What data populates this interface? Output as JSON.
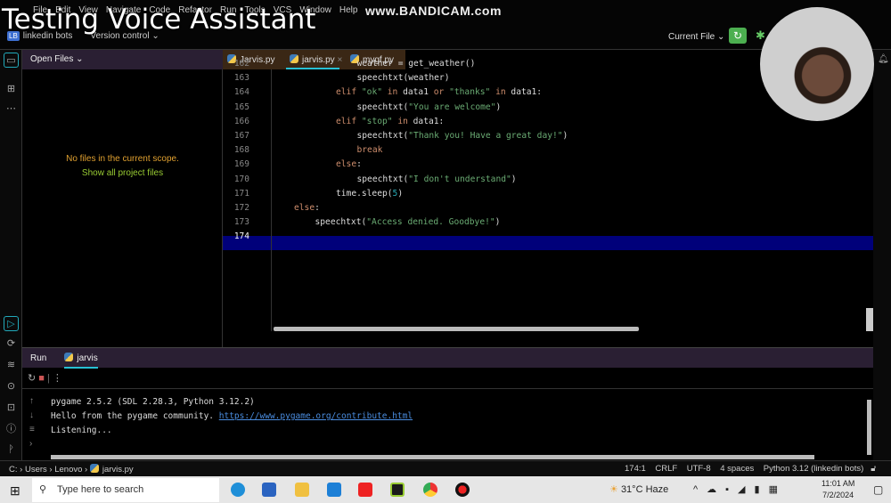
{
  "overlay": {
    "title": "Testing Voice Assistant",
    "watermark": "www.BANDICAM.com"
  },
  "menu": [
    "File",
    "Edit",
    "View",
    "Navigate",
    "Code",
    "Refactor",
    "Run",
    "Tools",
    "VCS",
    "Window",
    "Help"
  ],
  "project": {
    "badge": "LB",
    "name": "linkedin bots",
    "vcs": "Version control ⌄"
  },
  "toolbar": {
    "current_file": "Current File ⌄"
  },
  "sidebar": {
    "header": "Open Files ⌄",
    "empty": "No files in the current scope.",
    "show_all": "Show all project files"
  },
  "tabs": [
    {
      "label": "Jarvis.py"
    },
    {
      "label": "jarvis.py",
      "active": true,
      "close": "×"
    },
    {
      "label": "mygf.py"
    }
  ],
  "editor": {
    "lines": [
      {
        "n": "162",
        "indent": 3,
        "tokens": [
          {
            "t": "weather = get_weather()",
            "c": ""
          }
        ]
      },
      {
        "n": "163",
        "indent": 3,
        "tokens": [
          {
            "t": "speechtxt(weather)",
            "c": ""
          }
        ]
      },
      {
        "n": "164",
        "indent": 2,
        "tokens": [
          {
            "t": "elif ",
            "c": "kw"
          },
          {
            "t": "\"ok\"",
            "c": "st"
          },
          {
            "t": " in ",
            "c": "kw"
          },
          {
            "t": "data1 ",
            "c": ""
          },
          {
            "t": "or ",
            "c": "kw"
          },
          {
            "t": "\"thanks\"",
            "c": "st"
          },
          {
            "t": " in ",
            "c": "kw"
          },
          {
            "t": "data1:",
            "c": ""
          }
        ]
      },
      {
        "n": "165",
        "indent": 3,
        "tokens": [
          {
            "t": "speechtxt(",
            "c": ""
          },
          {
            "t": "\"You are welcome\"",
            "c": "st"
          },
          {
            "t": ")",
            "c": ""
          }
        ]
      },
      {
        "n": "166",
        "indent": 2,
        "tokens": [
          {
            "t": "elif ",
            "c": "kw"
          },
          {
            "t": "\"stop\"",
            "c": "st"
          },
          {
            "t": " in ",
            "c": "kw"
          },
          {
            "t": "data1:",
            "c": ""
          }
        ]
      },
      {
        "n": "167",
        "indent": 3,
        "tokens": [
          {
            "t": "speechtxt(",
            "c": ""
          },
          {
            "t": "\"Thank you! Have a great day!\"",
            "c": "st"
          },
          {
            "t": ")",
            "c": ""
          }
        ]
      },
      {
        "n": "168",
        "indent": 3,
        "tokens": [
          {
            "t": "break",
            "c": "kw"
          }
        ]
      },
      {
        "n": "169",
        "indent": 2,
        "tokens": [
          {
            "t": "else",
            "c": "kw"
          },
          {
            "t": ":",
            "c": ""
          }
        ]
      },
      {
        "n": "170",
        "indent": 3,
        "tokens": [
          {
            "t": "speechtxt(",
            "c": ""
          },
          {
            "t": "\"I don't understand\"",
            "c": "st"
          },
          {
            "t": ")",
            "c": ""
          }
        ]
      },
      {
        "n": "171",
        "indent": 2,
        "tokens": [
          {
            "t": "time.sleep(",
            "c": ""
          },
          {
            "t": "5",
            "c": "nm"
          },
          {
            "t": ")",
            "c": ""
          }
        ]
      },
      {
        "n": "172",
        "indent": 0,
        "tokens": [
          {
            "t": "else",
            "c": "kw"
          },
          {
            "t": ":",
            "c": ""
          }
        ]
      },
      {
        "n": "173",
        "indent": 1,
        "tokens": [
          {
            "t": "speechtxt(",
            "c": ""
          },
          {
            "t": "\"Access denied. Goodbye!\"",
            "c": "st"
          },
          {
            "t": ")",
            "c": ""
          }
        ]
      },
      {
        "n": "174",
        "indent": 0,
        "tokens": []
      }
    ]
  },
  "run": {
    "label": "Run",
    "tab": "jarvis",
    "close": "×",
    "output": [
      "pygame 2.5.2 (SDL 2.28.3, Python 3.12.2)",
      "Hello from the pygame community. ",
      "Listening..."
    ],
    "link": "https://www.pygame.org/contribute.html"
  },
  "status": {
    "path": [
      "C:",
      "Users",
      "Lenovo",
      "jarvis.py"
    ],
    "position": "174:1",
    "line_sep": "CRLF",
    "encoding": "UTF-8",
    "indent": "4 spaces",
    "interpreter": "Python 3.12 (linkedin bots)"
  },
  "taskbar": {
    "search": "Type here to search",
    "weather": "31°C  Haze",
    "time": "11:01 AM",
    "date": "7/2/2024"
  }
}
